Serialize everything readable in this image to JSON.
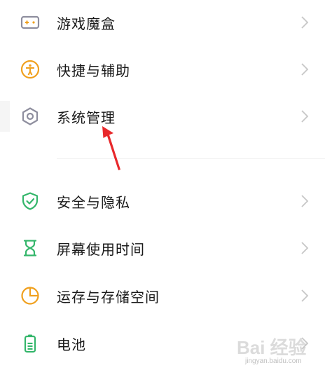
{
  "settings": {
    "items": [
      {
        "label": "游戏魔盒",
        "icon": "game-box-icon"
      },
      {
        "label": "快捷与辅助",
        "icon": "accessibility-icon"
      },
      {
        "label": "系统管理",
        "icon": "hexagon-settings-icon"
      },
      {
        "label": "安全与隐私",
        "icon": "shield-check-icon"
      },
      {
        "label": "屏幕使用时间",
        "icon": "hourglass-icon"
      },
      {
        "label": "运存与存储空间",
        "icon": "pie-storage-icon"
      },
      {
        "label": "电池",
        "icon": "battery-icon"
      }
    ]
  },
  "annotation": {
    "icon": "red-arrow-icon"
  },
  "watermark": {
    "text": "Bai 经验",
    "sub": "jingyan.baidu.com"
  },
  "colors": {
    "gray_icon": "#8e8e9e",
    "orange_icon": "#f0a01e",
    "green_icon": "#34b66b",
    "chevron": "#c7c7c7",
    "arrow": "#e8282b"
  }
}
